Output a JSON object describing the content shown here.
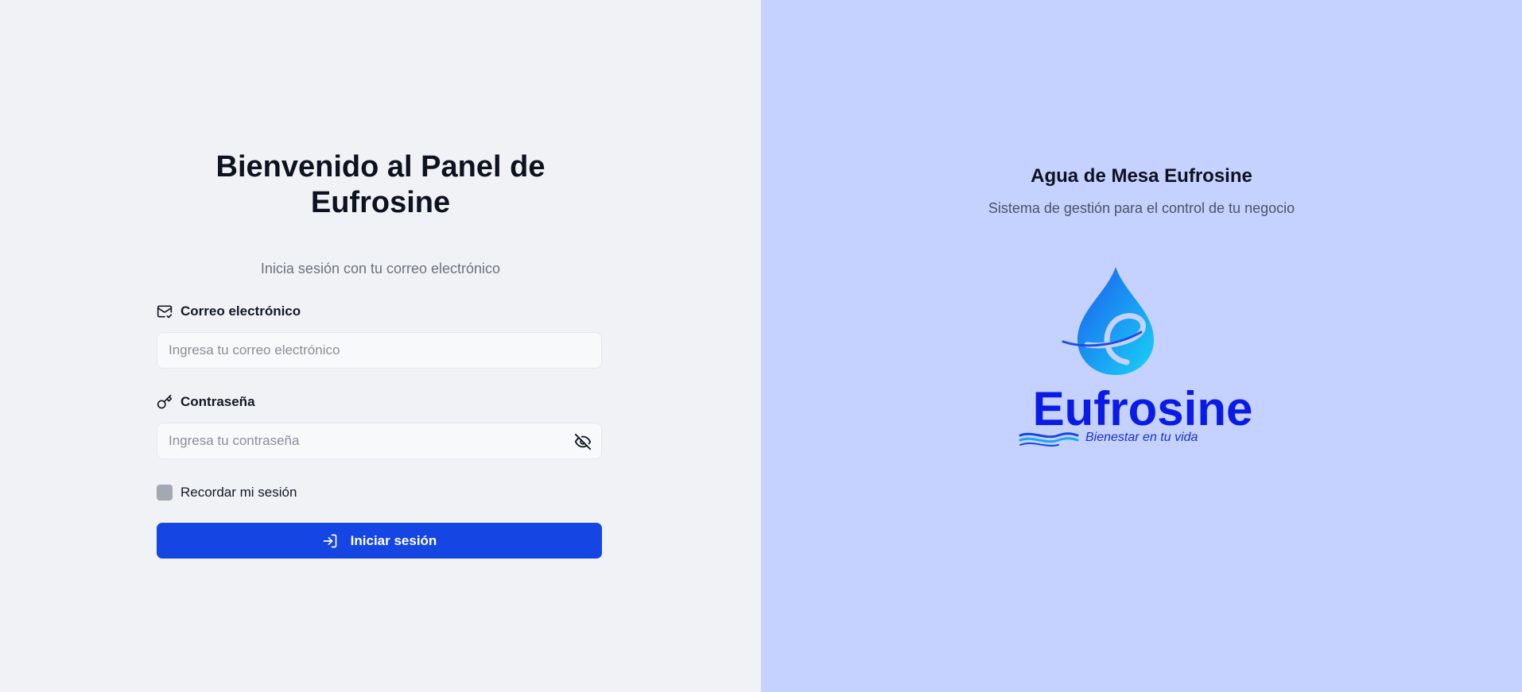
{
  "login": {
    "title_line1": "Bienvenido al Panel de",
    "title_line2": "Eufrosine",
    "subtitle": "Inicia sesión con tu correo electrónico",
    "email": {
      "label": "Correo electrónico",
      "placeholder": "Ingresa tu correo electrónico",
      "value": "",
      "icon": "mail-check-icon"
    },
    "password": {
      "label": "Contraseña",
      "placeholder": "Ingresa tu contraseña",
      "value": "",
      "icon": "key-icon",
      "toggle_icon": "eye-off-icon"
    },
    "remember_label": "Recordar mi sesión",
    "remember_checked": false,
    "submit_label": "Iniciar sesión",
    "submit_icon": "log-in-icon"
  },
  "brand": {
    "title": "Agua de Mesa Eufrosine",
    "subtitle": "Sistema de gestión para el control de tu negocio",
    "logo_word": "Eufrosine",
    "logo_tagline": "Bienestar en tu vida"
  },
  "colors": {
    "left_bg": "#f1f2f5",
    "right_bg": "#c5d1fe",
    "primary": "#1546e3",
    "logo_blue": "#0a1be6",
    "drop_cyan": "#19d3f5"
  }
}
